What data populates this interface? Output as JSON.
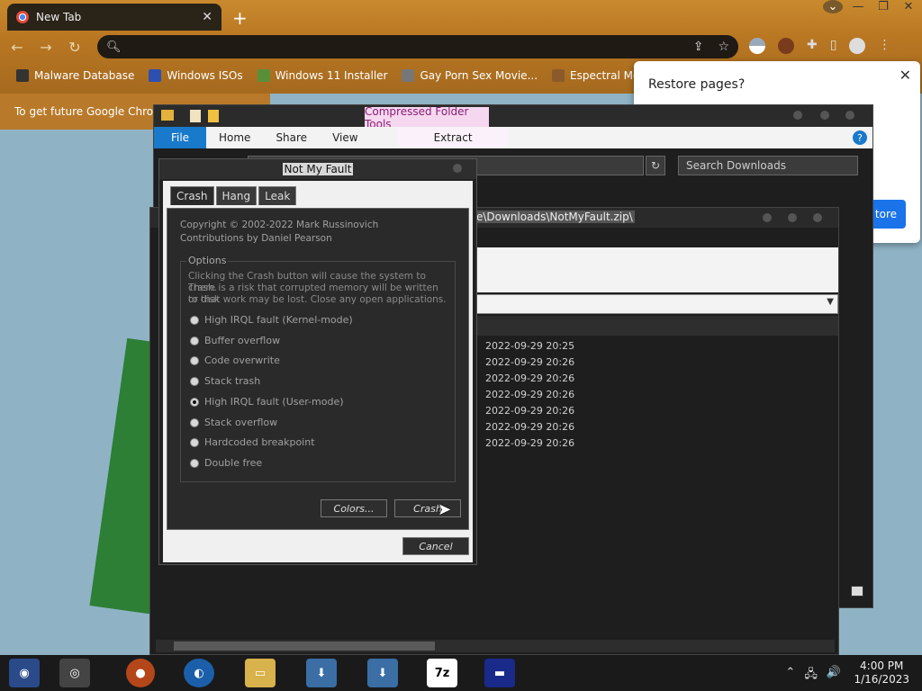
{
  "browser": {
    "tab_title": "New Tab",
    "tab_close": "✕",
    "new_tab": "+",
    "window_controls": [
      "⌄",
      "—",
      "❐",
      "✕"
    ],
    "nav": [
      "←",
      "→",
      "↻"
    ],
    "omnibox_icons": [
      "share-icon",
      "star-icon"
    ],
    "bookmarks": [
      {
        "label": "Malware Database",
        "color": "#333"
      },
      {
        "label": "Windows ISOs",
        "color": "#2d4fb0"
      },
      {
        "label": "Windows 11 Installer",
        "color": "#5a8f3a"
      },
      {
        "label": "Gay Porn Sex Movie...",
        "color": "#777"
      },
      {
        "label": "Espectral McGee",
        "color": "#8a5a2a"
      }
    ],
    "infobar_text": "To get future Google Chrom",
    "restore": {
      "title": "Restore pages?",
      "button": "tore",
      "close": "✕"
    }
  },
  "explorer": {
    "context_tab": "Compressed Folder Tools",
    "ribbon": {
      "file": "File",
      "home": "Home",
      "share": "Share",
      "view": "View",
      "extract": "Extract"
    },
    "search_placeholder": "Search Downloads",
    "zip_path": "e\\Downloads\\NotMyFault.zip\\",
    "dates": [
      "2022-09-29 20:25",
      "2022-09-29 20:26",
      "2022-09-29 20:26",
      "2022-09-29 20:26",
      "2022-09-29 20:26",
      "2022-09-29 20:26",
      "2022-09-29 20:26"
    ]
  },
  "nmf": {
    "title": "Not My Fault",
    "tabs": [
      "Crash",
      "Hang",
      "Leak"
    ],
    "copyright": "Copyright © 2002-2022 Mark Russinovich",
    "contributions": "Contributions by Daniel Pearson",
    "options_label": "Options",
    "desc1": "Clicking the Crash button will cause the system to crash.",
    "desc2": "There is a risk that corrupted memory will be written to disk",
    "desc3": "or that work may be lost. Close any open applications.",
    "options": [
      {
        "label": "High IRQL fault (Kernel-mode)",
        "selected": false
      },
      {
        "label": "Buffer overflow",
        "selected": false
      },
      {
        "label": "Code overwrite",
        "selected": false
      },
      {
        "label": "Stack trash",
        "selected": false
      },
      {
        "label": "High IRQL fault (User-mode)",
        "selected": true
      },
      {
        "label": "Stack overflow",
        "selected": false
      },
      {
        "label": "Hardcoded breakpoint",
        "selected": false
      },
      {
        "label": "Double free",
        "selected": false
      }
    ],
    "colors_button": "Colors...",
    "crash_button": "Crash",
    "cancel_button": "Cancel"
  },
  "taskbar": {
    "time": "4:00 PM",
    "date": "1/16/2023",
    "sevenzip_label": "7z",
    "tray": [
      "⌃",
      "🖧",
      "🔊"
    ]
  }
}
